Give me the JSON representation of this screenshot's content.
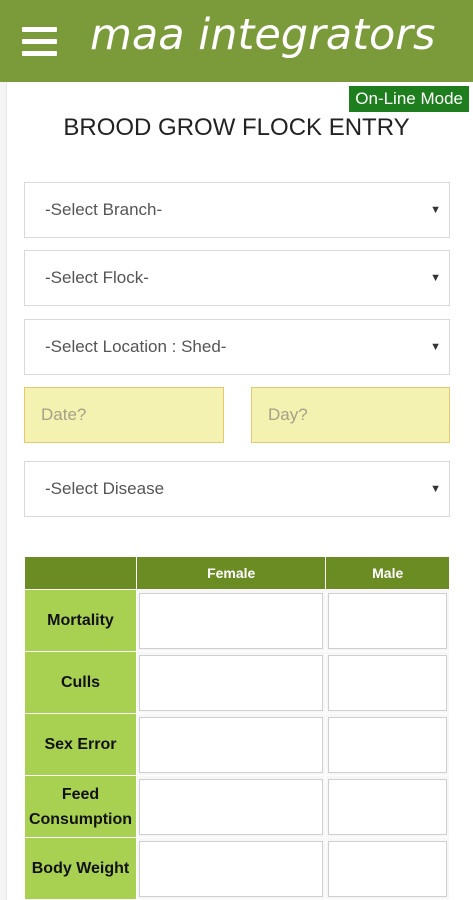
{
  "header": {
    "brand": "maa integrators",
    "menu_icon": "hamburger-menu-icon"
  },
  "status": {
    "mode": "On-Line Mode",
    "color": "#1e7e1e"
  },
  "page": {
    "title": "BROOD GROW FLOCK ENTRY"
  },
  "form": {
    "branch": "-Select Branch-",
    "flock": "-Select Flock-",
    "location": "-Select Location : Shed-",
    "date_placeholder": "Date?",
    "day_placeholder": "Day?",
    "disease": "-Select Disease"
  },
  "table": {
    "columns": [
      "",
      "Female",
      "Male"
    ],
    "rows": [
      "Mortality",
      "Culls",
      "Sex Error",
      "Feed Consumption",
      "Body Weight"
    ]
  },
  "colors": {
    "header": "#7b9a3a",
    "table_header": "#6b8b23",
    "row_label": "#a9d151",
    "date_field": "#f4f2b0"
  }
}
